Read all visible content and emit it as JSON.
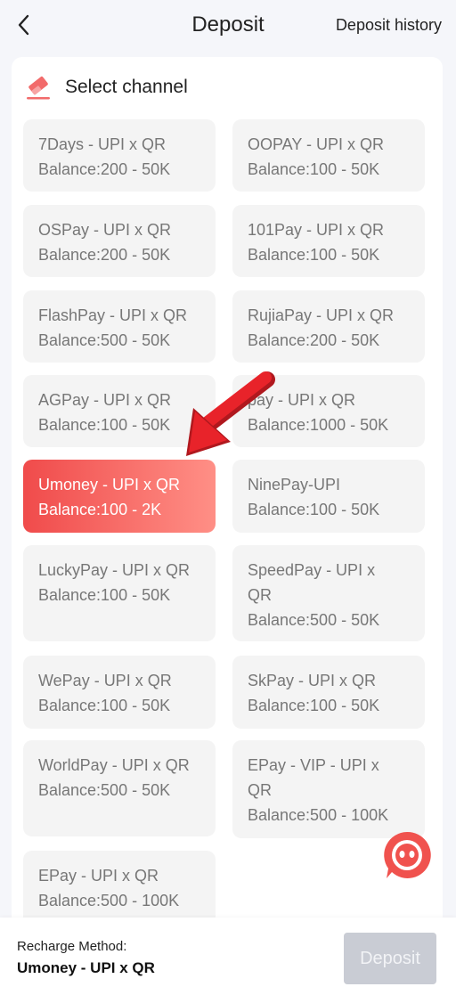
{
  "header": {
    "title": "Deposit",
    "history_label": "Deposit history",
    "back_icon": "chevron-left-icon"
  },
  "panel": {
    "title": "Select channel",
    "icon": "eraser-icon"
  },
  "channels": [
    {
      "name": "7Days - UPI x QR",
      "balance": "Balance:200 - 50K",
      "selected": false
    },
    {
      "name": "OOPAY - UPI x QR",
      "balance": "Balance:100 - 50K",
      "selected": false
    },
    {
      "name": "OSPay - UPI x QR",
      "balance": "Balance:200 - 50K",
      "selected": false
    },
    {
      "name": "101Pay - UPI x QR",
      "balance": "Balance:100 - 50K",
      "selected": false
    },
    {
      "name": "FlashPay - UPI x QR",
      "balance": "Balance:500 - 50K",
      "selected": false
    },
    {
      "name": "RujiaPay - UPI x QR",
      "balance": "Balance:200 - 50K",
      "selected": false
    },
    {
      "name": "AGPay - UPI x QR",
      "balance": "Balance:100 - 50K",
      "selected": false
    },
    {
      "name": "pay - UPI x QR",
      "balance": "Balance:1000 - 50K",
      "selected": false
    },
    {
      "name": "Umoney - UPI x QR",
      "balance": "Balance:100 - 2K",
      "selected": true
    },
    {
      "name": "NinePay-UPI",
      "balance": "Balance:100 - 50K",
      "selected": false
    },
    {
      "name": "LuckyPay - UPI x QR",
      "balance": "Balance:100 - 50K",
      "selected": false
    },
    {
      "name": "SpeedPay - UPI x QR",
      "balance": "Balance:500 - 50K",
      "selected": false
    },
    {
      "name": "WePay - UPI x QR",
      "balance": "Balance:100 - 50K",
      "selected": false
    },
    {
      "name": "SkPay - UPI x QR",
      "balance": "Balance:100 - 50K",
      "selected": false
    },
    {
      "name": "WorldPay - UPI x QR",
      "balance": "Balance:500 - 50K",
      "selected": false
    },
    {
      "name": "EPay - VIP - UPI x QR",
      "balance": "Balance:500 - 100K",
      "selected": false
    },
    {
      "name": "EPay - UPI x QR",
      "balance": "Balance:500 - 100K",
      "selected": false
    }
  ],
  "footer": {
    "method_label": "Recharge Method:",
    "method_value": "Umoney - UPI x QR",
    "deposit_label": "Deposit"
  },
  "colors": {
    "accent": "#f04b4b",
    "accent_light": "#ff8f86",
    "card_bg": "#f4f4f4",
    "button_disabled": "#c9ccd4",
    "arrow": "#e8232a"
  },
  "chat_icon": "chat-bubble-icon"
}
